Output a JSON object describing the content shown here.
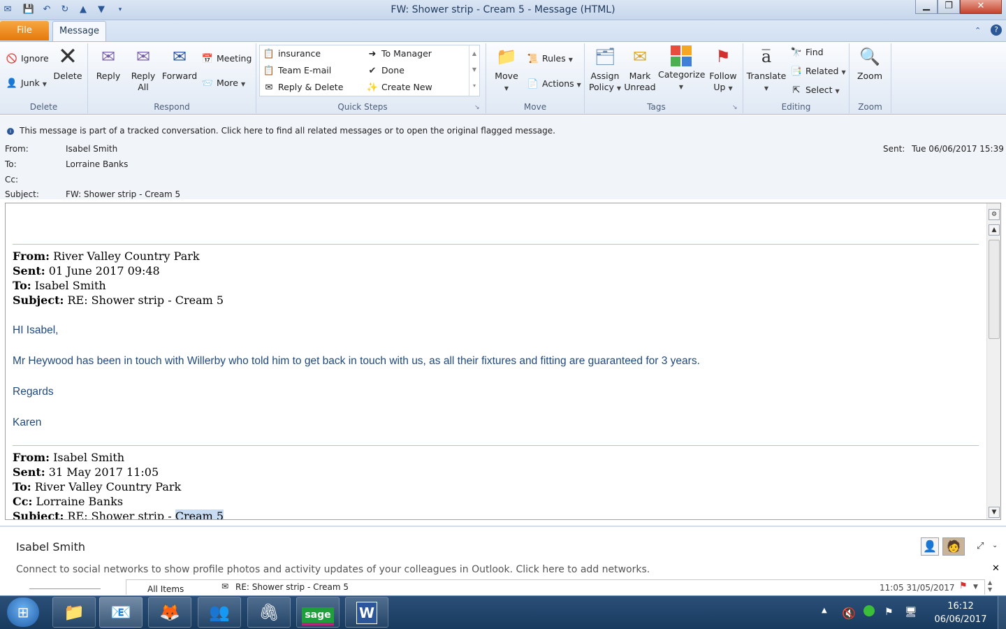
{
  "window": {
    "title": "FW: Shower strip - Cream 5  -  Message (HTML)",
    "min_icon": "minimize-icon",
    "max_icon": "restore-icon",
    "close_icon": "close-icon"
  },
  "tabs": {
    "file": "File",
    "message": "Message"
  },
  "ribbon": {
    "delete_group": {
      "ignore": "Ignore",
      "junk": "Junk",
      "delete": "Delete",
      "label": "Delete"
    },
    "respond_group": {
      "reply": "Reply",
      "reply_all_1": "Reply",
      "reply_all_2": "All",
      "forward": "Forward",
      "meeting": "Meeting",
      "more": "More",
      "label": "Respond"
    },
    "quick_steps": {
      "items": [
        "insurance",
        "Team E-mail",
        "Reply & Delete",
        "To Manager",
        "Done",
        "Create New"
      ],
      "label": "Quick Steps"
    },
    "move_group": {
      "move": "Move",
      "rules": "Rules",
      "actions": "Actions",
      "label": "Move"
    },
    "tags_group": {
      "assign_1": "Assign",
      "assign_2": "Policy",
      "mark_1": "Mark",
      "mark_2": "Unread",
      "categorize": "Categorize",
      "follow_1": "Follow",
      "follow_2": "Up",
      "label": "Tags"
    },
    "editing_group": {
      "translate": "Translate",
      "find": "Find",
      "related": "Related",
      "select": "Select",
      "label": "Editing"
    },
    "zoom_group": {
      "zoom": "Zoom",
      "label": "Zoom"
    }
  },
  "info_bar": "This message is part of a tracked conversation. Click here to find all related messages or to open the original flagged message.",
  "header": {
    "from_label": "From:",
    "from": "Isabel Smith",
    "to_label": "To:",
    "to": "Lorraine Banks",
    "cc_label": "Cc:",
    "subject_label": "Subject:",
    "subject": "FW: Shower strip - Cream 5",
    "sent_label": "Sent:",
    "sent": "Tue 06/06/2017 15:39"
  },
  "body": {
    "msg1": {
      "from_label": "From:",
      "from": " River Valley Country Park",
      "sent_label": "Sent:",
      "sent": " 01 June 2017 09:48",
      "to_label": "To:",
      "to": " Isabel Smith",
      "subject_label": "Subject:",
      "subject": " RE: Shower strip - Cream 5",
      "greeting": "HI Isabel,",
      "para": "Mr Heywood has been in touch with Willerby who told him to get back in touch with us, as all their fixtures and fitting are guaranteed for 3 years.",
      "regards": "Regards",
      "sign": "Karen"
    },
    "msg2": {
      "from_label": "From:",
      "from": " Isabel Smith",
      "sent_label": "Sent:",
      "sent": " 31 May 2017 11:05",
      "to_label": "To:",
      "to": " River Valley Country Park",
      "cc_label": "Cc:",
      "cc": " Lorraine Banks",
      "subject_label": "Subject:",
      "subject_pre": " RE: Shower strip - ",
      "subject_hl": "Cream 5"
    }
  },
  "people_pane": {
    "name": "Isabel Smith",
    "social": "Connect to social networks to show profile photos and activity updates of your colleagues in Outlook. Click here to add networks.",
    "tab_all": "All Items",
    "row_subject": "RE: Shower strip - Cream 5",
    "row_date": "11:05 31/05/2017"
  },
  "taskbar": {
    "time": "16:12",
    "date": "06/06/2017",
    "apps": [
      "windows-start-icon",
      "file-explorer-icon",
      "outlook-icon",
      "firefox-icon",
      "contacts-app-icon",
      "stapler-app-icon",
      "sage-icon",
      "word-icon"
    ],
    "sage_label": "sage",
    "word_label": "W"
  },
  "colors": {
    "accent": "#2b5797",
    "file_tab": "#e4790b",
    "body_blue": "#1f497d",
    "taskbar": "#183a5e"
  }
}
